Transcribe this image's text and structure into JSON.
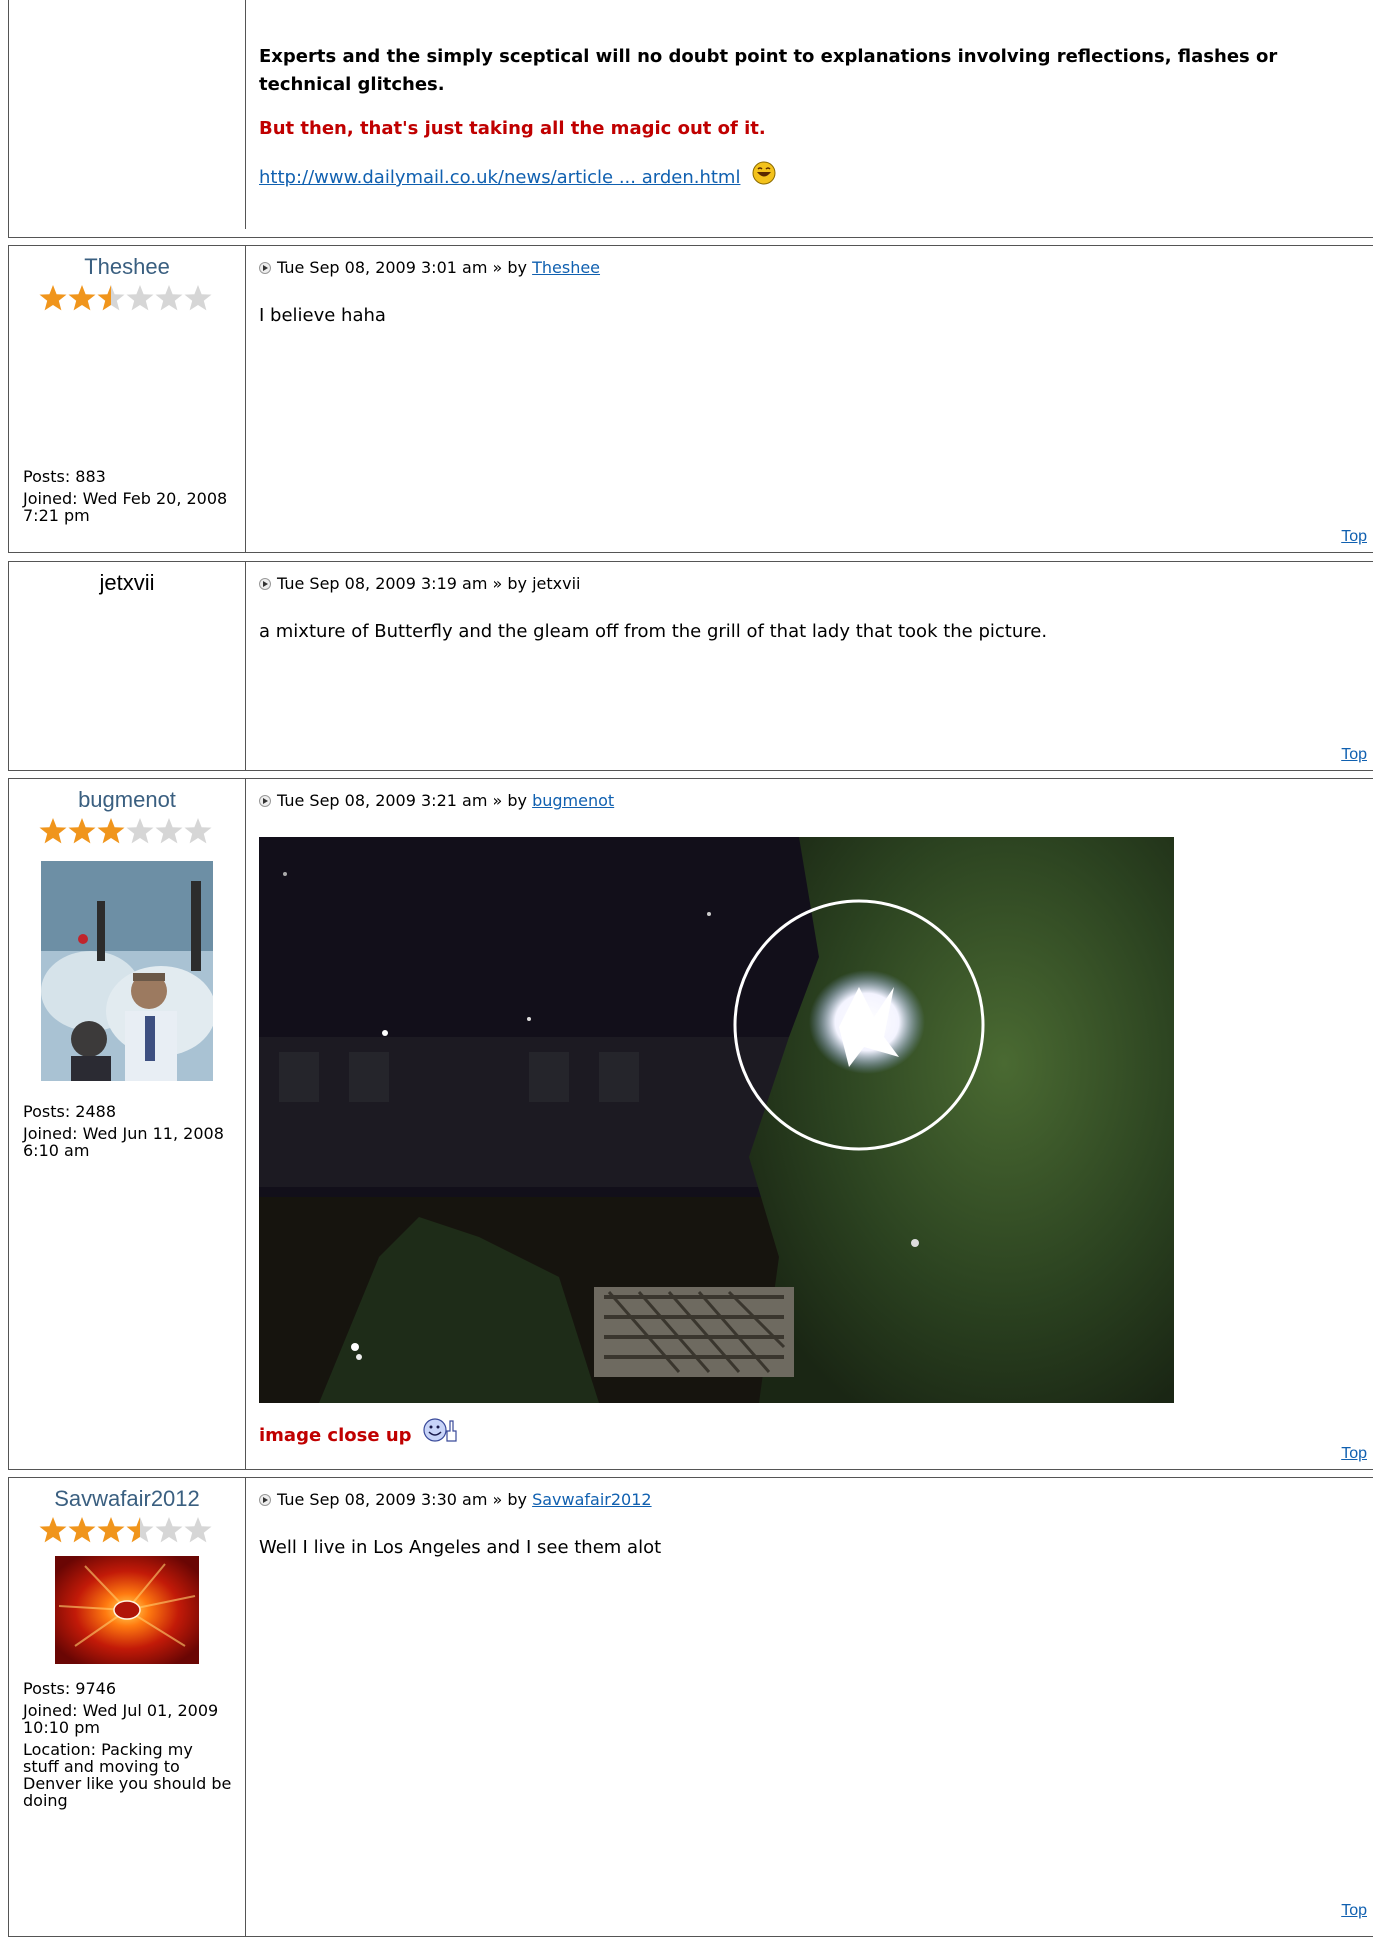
{
  "post0": {
    "para1": "Experts and the simply sceptical will no doubt point to explanations involving reflections, flashes or technical glitches.",
    "para2": "But then, that's just taking all the magic out of it.",
    "link": "http://www.dailymail.co.uk/news/article ... arden.html"
  },
  "posts": [
    {
      "username": "Theshee",
      "rating_stars": 2.5,
      "date": "Tue Sep 08, 2009 3:01 am",
      "by": "» by",
      "author": "Theshee",
      "message": "I believe  haha",
      "posts_label": "Posts: 883",
      "joined_label": "Joined: Wed Feb 20, 2008 7:21 pm",
      "top": "Top"
    },
    {
      "username": "jetxvii",
      "date": "Tue Sep 08, 2009 3:19 am",
      "by": "» by",
      "author": "jetxvii",
      "message": "a mixture of Butterfly and the gleam off from the grill of that lady that took the picture.",
      "top": "Top"
    },
    {
      "username": "bugmenot",
      "rating_stars": 3,
      "date": "Tue Sep 08, 2009 3:21 am",
      "by": "» by",
      "author": "bugmenot",
      "caption": "image close up",
      "posts_label": "Posts: 2488",
      "joined_label": "Joined: Wed Jun 11, 2008 6:10 am",
      "top": "Top"
    },
    {
      "username": "Savwafair2012",
      "rating_stars": 3.5,
      "date": "Tue Sep 08, 2009 3:30 am",
      "by": "» by",
      "author": "Savwafair2012",
      "message": "Well I live in Los Angeles and I see them alot",
      "posts_label": "Posts: 9746",
      "joined_label": "Joined: Wed Jul 01, 2009 10:10 pm",
      "location_label": "Location: Packing my stuff and moving to Denver like you should be doing",
      "top": "Top"
    }
  ],
  "colors": {
    "username": "#3a5f80",
    "link": "#1060b0",
    "highlight_red": "#c00000",
    "star_filled": "#f0951c",
    "star_empty": "#d6d6d6"
  }
}
